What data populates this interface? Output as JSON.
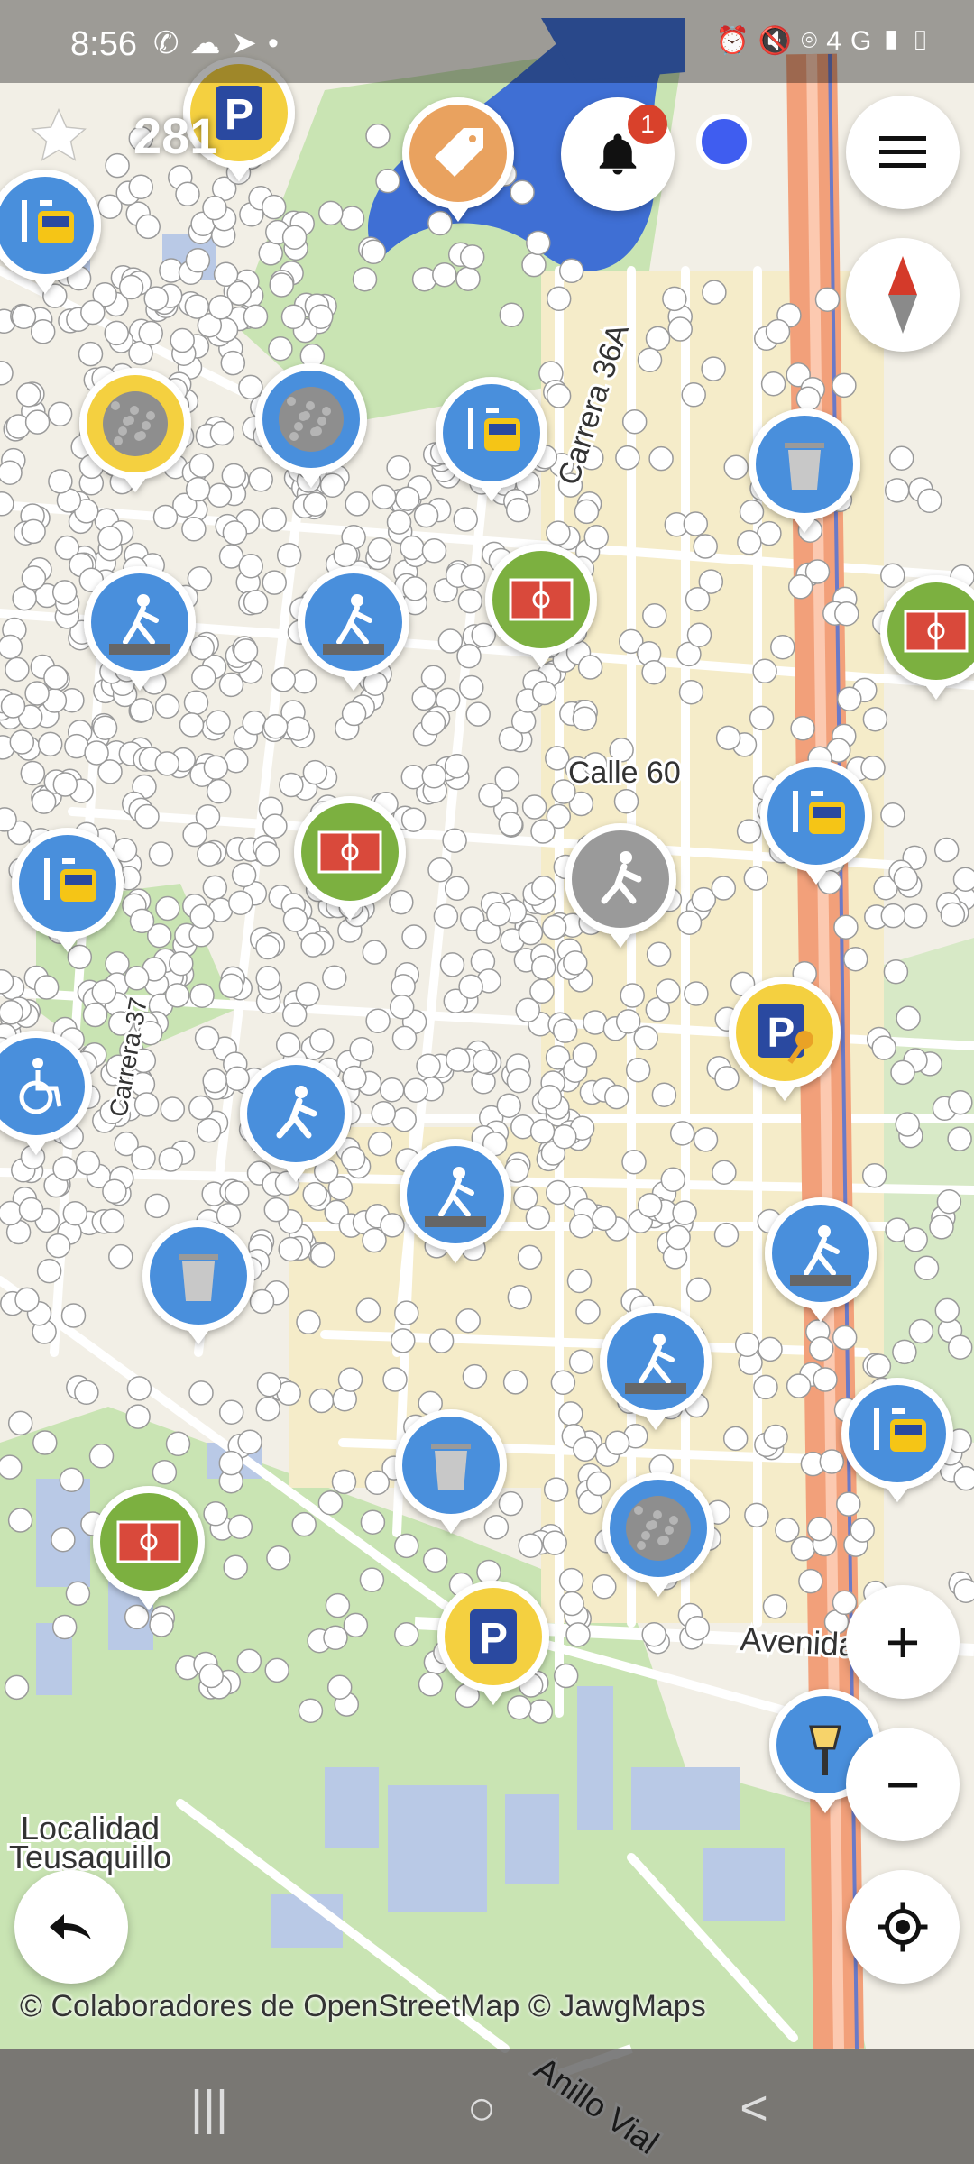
{
  "status_bar": {
    "time": "8:56",
    "left_icons": [
      "whatsapp-icon",
      "cloud-icon",
      "telegram-icon",
      "dot-icon"
    ],
    "right_icons": [
      "alarm-icon",
      "mute-icon",
      "location-icon",
      "volte-icon",
      "4g-icon",
      "signal-icon",
      "battery-icon"
    ],
    "network_label": "4G"
  },
  "top_bar": {
    "star_count": "281",
    "notification_badge": "1"
  },
  "map_labels": {
    "street_1": "Carrera 36A",
    "street_2": "Calle 60",
    "street_3": "Carrera 37",
    "avenue": "Avenida",
    "ring_road": "Anillo Vial",
    "locality": "Localidad\nTeusaquillo"
  },
  "attribution": "© Colaboradores de OpenStreetMap  © JawgMaps",
  "colors": {
    "pin_blue": "#4a8fdc",
    "pin_green": "#7bb041",
    "pin_yellow": "#f4d03f",
    "pin_orange": "#e9a25f",
    "pin_gray": "#9a9a9a",
    "map_bg": "#f2efe6",
    "park": "#c9e4b3",
    "water": "#3f6fd4",
    "building": "#b9c9e6",
    "highway": "#f2a07a"
  },
  "pins": [
    {
      "type": "parking",
      "icon": "parking-icon"
    },
    {
      "type": "bus-stop",
      "icon": "bus-stop-icon"
    },
    {
      "type": "tag",
      "icon": "tag-icon"
    },
    {
      "type": "surface",
      "icon": "surface-icon"
    },
    {
      "type": "surface",
      "icon": "surface-icon"
    },
    {
      "type": "bus-stop",
      "icon": "bus-stop-icon"
    },
    {
      "type": "waste-basket",
      "icon": "trash-icon"
    },
    {
      "type": "crossing",
      "icon": "pedestrian-crossing-icon"
    },
    {
      "type": "crossing",
      "icon": "pedestrian-crossing-icon"
    },
    {
      "type": "pitch",
      "icon": "soccer-field-icon"
    },
    {
      "type": "pitch",
      "icon": "soccer-field-icon"
    },
    {
      "type": "bus-stop",
      "icon": "bus-stop-icon"
    },
    {
      "type": "bus-stop",
      "icon": "bus-stop-icon"
    },
    {
      "type": "pitch",
      "icon": "soccer-field-icon"
    },
    {
      "type": "pedestrian",
      "icon": "pedestrian-icon"
    },
    {
      "type": "wheelchair",
      "icon": "wheelchair-icon"
    },
    {
      "type": "pedestrian",
      "icon": "pedestrian-icon"
    },
    {
      "type": "parking-private",
      "icon": "parking-key-icon"
    },
    {
      "type": "crossing",
      "icon": "pedestrian-crossing-icon"
    },
    {
      "type": "waste-basket",
      "icon": "trash-icon"
    },
    {
      "type": "crossing",
      "icon": "pedestrian-crossing-icon"
    },
    {
      "type": "crossing",
      "icon": "pedestrian-crossing-icon"
    },
    {
      "type": "waste-basket",
      "icon": "trash-icon"
    },
    {
      "type": "surface",
      "icon": "surface-icon"
    },
    {
      "type": "bus-stop",
      "icon": "bus-stop-icon"
    },
    {
      "type": "pitch",
      "icon": "soccer-field-icon"
    },
    {
      "type": "parking",
      "icon": "parking-icon"
    },
    {
      "type": "street-lamp",
      "icon": "street-lamp-icon"
    }
  ],
  "controls": {
    "menu_icon": "hamburger-menu-icon",
    "compass_icon": "compass-icon",
    "zoom_in": "+",
    "zoom_out": "−",
    "locate_icon": "gps-locate-icon",
    "undo_icon": "undo-icon"
  },
  "nav_bar": {
    "recents": "|||",
    "home": "○",
    "back": "<"
  }
}
